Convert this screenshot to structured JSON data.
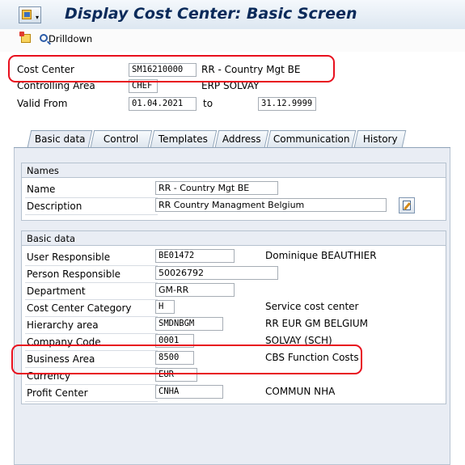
{
  "window": {
    "title": "Display Cost Center: Basic Screen"
  },
  "toolbar": {
    "drilldown_label": "Drilldown"
  },
  "header": {
    "cost_center": {
      "label": "Cost Center",
      "value": "SM16210000",
      "text": "RR - Country Mgt BE"
    },
    "controlling_area": {
      "label": "Controlling Area",
      "value": "CHEF",
      "text": "ERP SOLVAY"
    },
    "valid_from": {
      "label": "Valid From",
      "value": "01.04.2021",
      "to_label": "to",
      "to_value": "31.12.9999"
    }
  },
  "tabs": [
    {
      "label": "Basic data",
      "active": true
    },
    {
      "label": "Control"
    },
    {
      "label": "Templates"
    },
    {
      "label": "Address"
    },
    {
      "label": "Communication"
    },
    {
      "label": "History"
    }
  ],
  "names": {
    "section_title": "Names",
    "name": {
      "label": "Name",
      "value": "RR - Country Mgt BE"
    },
    "description": {
      "label": "Description",
      "value": "RR Country Managment Belgium"
    }
  },
  "basic_data": {
    "section_title": "Basic data",
    "rows": [
      {
        "label": "User Responsible",
        "value": "BE01472",
        "text": "Dominique BEAUTHIER"
      },
      {
        "label": "Person Responsible",
        "value": "50026792",
        "text": ""
      },
      {
        "label": "Department",
        "value": "GM-RR",
        "text": ""
      },
      {
        "label": "Cost Center Category",
        "value": "H",
        "text": "Service cost center"
      },
      {
        "label": "Hierarchy area",
        "value": "SMDNBGM",
        "text": "RR EUR GM BELGIUM"
      },
      {
        "label": "Company Code",
        "value": "0001",
        "text": "SOLVAY (SCH)"
      },
      {
        "label": "Business Area",
        "value": "8500",
        "text": "CBS Function Costs"
      },
      {
        "label": "Currency",
        "value": "EUR",
        "text": ""
      },
      {
        "label": "Profit Center",
        "value": "CNHA",
        "text": "COMMUN NHA"
      }
    ]
  },
  "colors": {
    "highlight": "#e8101e",
    "title": "#0a2a5a"
  }
}
